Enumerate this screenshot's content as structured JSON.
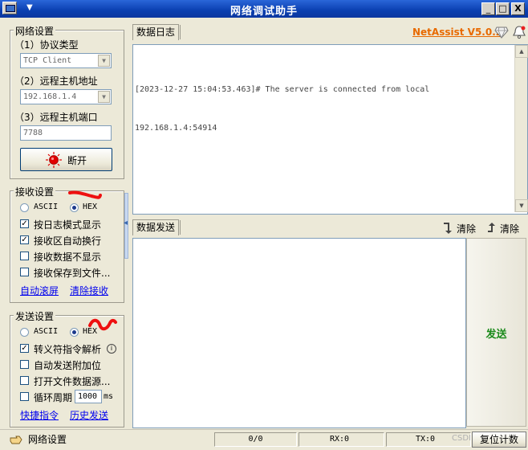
{
  "window": {
    "title": "网络调试助手",
    "minimize": "_",
    "maximize": "□",
    "close": "X"
  },
  "network_settings": {
    "legend": "网络设置",
    "protocol_label": "（1）协议类型",
    "protocol_value": "TCP Client",
    "host_label": "（2）远程主机地址",
    "host_value": "192.168.1.4",
    "port_label": "（3）远程主机端口",
    "port_value": "7788",
    "disconnect_button": "断开"
  },
  "receive_settings": {
    "legend": "接收设置",
    "ascii_label": "ASCII",
    "hex_label": "HEX",
    "mode_selected": "HEX",
    "options": [
      {
        "label": "按日志模式显示",
        "checked": true
      },
      {
        "label": "接收区自动换行",
        "checked": true
      },
      {
        "label": "接收数据不显示",
        "checked": false
      },
      {
        "label": "接收保存到文件...",
        "checked": false
      }
    ],
    "auto_scroll_link": "自动滚屏",
    "clear_receive_link": "清除接收"
  },
  "send_settings": {
    "legend": "发送设置",
    "ascii_label": "ASCII",
    "hex_label": "HEX",
    "mode_selected": "HEX",
    "options": [
      {
        "label": "转义符指令解析",
        "checked": true
      },
      {
        "label": "自动发送附加位",
        "checked": false
      },
      {
        "label": "打开文件数据源...",
        "checked": false
      },
      {
        "label": "循环周期",
        "checked": false
      }
    ],
    "cycle_value": "1000",
    "cycle_unit": "ms",
    "shortcut_link": "快捷指令",
    "history_link": "历史发送"
  },
  "data_log": {
    "tab_label": "数据日志",
    "brand": "NetAssist V5.0.2",
    "lines": [
      "[2023-12-27 15:04:53.463]# The server is connected from local",
      "192.168.1.4:54914"
    ]
  },
  "data_send": {
    "tab_label": "数据发送",
    "clear_label_1": "清除",
    "clear_label_2": "清除",
    "send_button": "发送"
  },
  "status_bar": {
    "label": "网络设置",
    "counter": "0/0",
    "rx": "RX:0",
    "tx": "TX:0",
    "reset_button": "复位计数",
    "watermark": "CSDI"
  },
  "colors": {
    "brand": "#e86a00",
    "send": "#1a8a1a",
    "link": "#0000ee",
    "title_bar": "#0a3fb0"
  }
}
